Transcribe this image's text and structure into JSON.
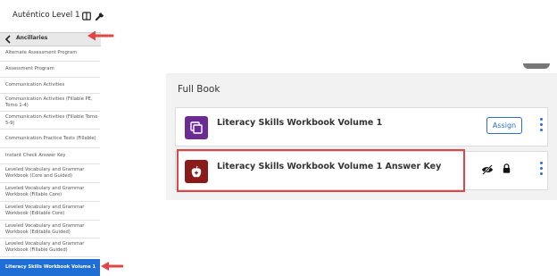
{
  "sidebar": {
    "title": "Auténtico Level 1",
    "ancillaries_label": "Ancillaries",
    "items": [
      {
        "label": "Alternate Assessment Program"
      },
      {
        "label": "Assessment Program"
      },
      {
        "label": "Communication Activities"
      },
      {
        "label": "Communication Activities (Fillable PE, Tomo 1-4)"
      },
      {
        "label": "Communication Activities (Fillable Tomo 5-9)"
      },
      {
        "label": "Communication Practice Tests (Fillable)"
      },
      {
        "label": "Instant Check Answer Key"
      },
      {
        "label": "Leveled Vocabulary and Grammar Workbook (Core and Guided)"
      },
      {
        "label": "Leveled Vocabulary and Grammar Workbook (Fillable Core)"
      },
      {
        "label": "Leveled Vocabulary and Grammar Workbook (Editable Core)"
      },
      {
        "label": "Leveled Vocabulary and Grammar Workbook (Editable Guided)"
      },
      {
        "label": "Leveled Vocabulary and Grammar Workbook (Fillable Guided)"
      },
      {
        "label": "Literacy Skills Workbook Volume 1",
        "active": true
      }
    ]
  },
  "main": {
    "section_title": "Full Book",
    "items": [
      {
        "title": "Literacy Skills Workbook Volume 1",
        "icon": "stack-icon",
        "action_label": "Assign"
      },
      {
        "title": "Literacy Skills Workbook Volume 1 Answer Key",
        "icon": "apple-icon"
      }
    ]
  },
  "colors": {
    "active_item": "#1f6ed6",
    "accent_blue": "#2a6fd1",
    "purple_icon": "#6b2c91",
    "maroon_icon": "#8b1a1a",
    "annotation_red": "#e04646"
  }
}
